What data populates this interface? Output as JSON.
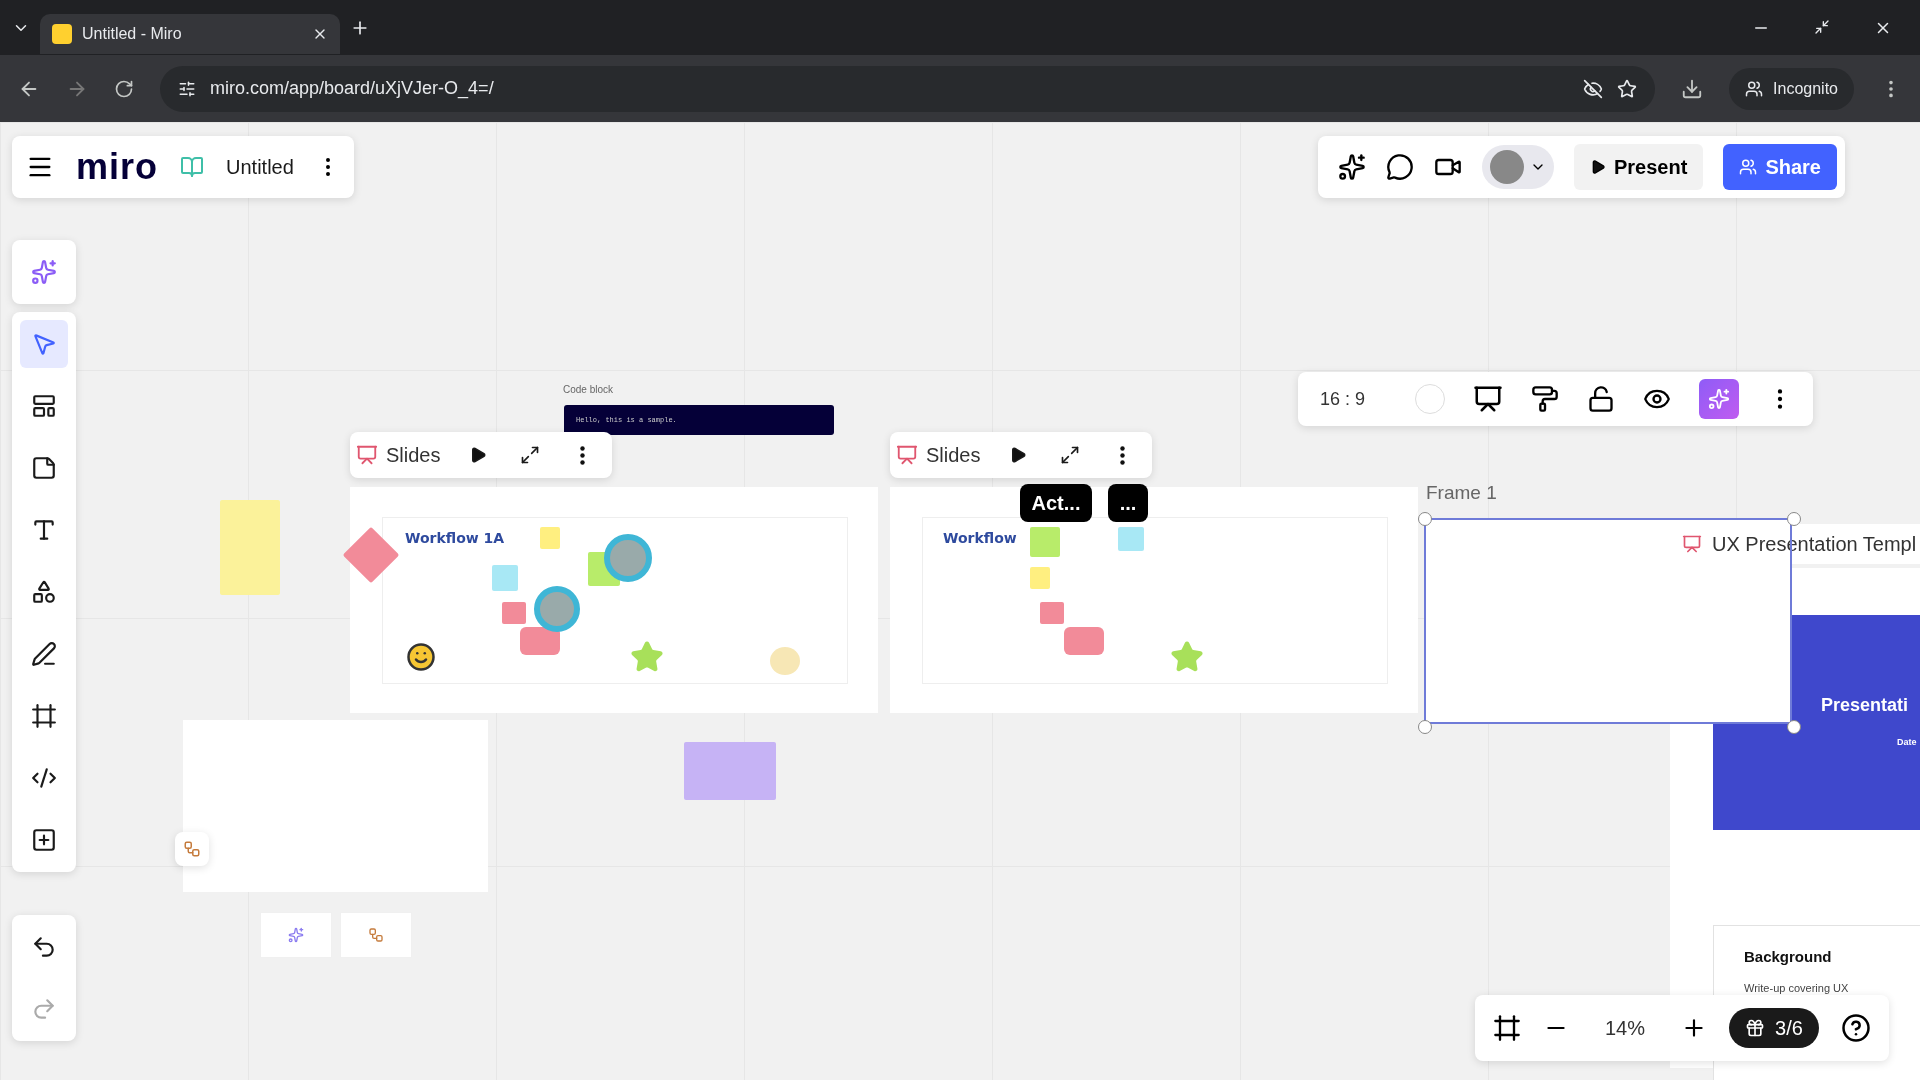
{
  "browser": {
    "tab_title": "Untitled - Miro",
    "url": "miro.com/app/board/uXjVJer-O_4=/",
    "profile": "Incognito"
  },
  "board_header": {
    "logo": "miro",
    "board_name": "Untitled"
  },
  "top_actions": {
    "present": "Present",
    "share": "Share"
  },
  "left_tools": [
    {
      "kind": "ai",
      "selected": false
    },
    {
      "kind": "select",
      "selected": true
    },
    {
      "kind": "templates",
      "selected": false
    },
    {
      "kind": "sticky",
      "selected": false
    },
    {
      "kind": "text",
      "selected": false
    },
    {
      "kind": "shapes",
      "selected": false
    },
    {
      "kind": "pen",
      "selected": false
    },
    {
      "kind": "frame",
      "selected": false
    },
    {
      "kind": "embed",
      "selected": false
    },
    {
      "kind": "add",
      "selected": false
    }
  ],
  "canvas": {
    "code_block": {
      "label": "Code block",
      "code": "Hello, this is a sample."
    },
    "slides": [
      {
        "toolbar_label": "Slides",
        "title": "Workflow 1A"
      },
      {
        "toolbar_label": "Slides",
        "title": "Workflow"
      }
    ],
    "tags": [
      "Act...",
      "..."
    ],
    "frame_label": "Frame 1",
    "presentation": {
      "label": "UX Presentation Templ",
      "slide_title": "Presentati",
      "slide_date": "Date",
      "card_title": "Background",
      "card_text": "Write-up covering UX"
    }
  },
  "frame_toolbar": {
    "ratio": "16 : 9"
  },
  "zoom_bar": {
    "zoom": "14%",
    "counter": "3/6"
  }
}
